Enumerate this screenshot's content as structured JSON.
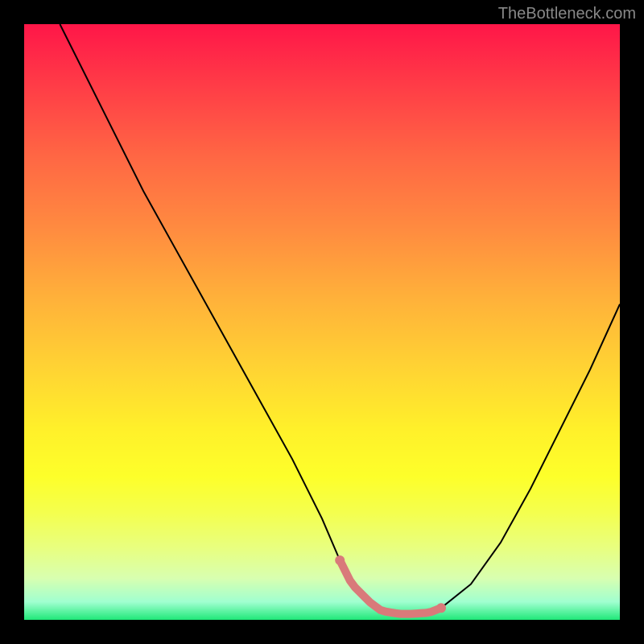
{
  "watermark": "TheBottleneck.com",
  "chart_data": {
    "type": "line",
    "title": "",
    "xlabel": "",
    "ylabel": "",
    "xlim": [
      0,
      100
    ],
    "ylim": [
      0,
      100
    ],
    "series": [
      {
        "name": "curve",
        "x": [
          6,
          10,
          15,
          20,
          25,
          30,
          35,
          40,
          45,
          50,
          53,
          55,
          58,
          60,
          63,
          65,
          68,
          70,
          75,
          80,
          85,
          90,
          95,
          100
        ],
        "values": [
          100,
          92,
          82,
          72,
          63,
          54,
          45,
          36,
          27,
          17,
          10,
          6,
          3,
          1.5,
          1,
          1,
          1.2,
          2,
          6,
          13,
          22,
          32,
          42,
          53
        ]
      }
    ],
    "highlight_range": {
      "x_start": 53,
      "x_end": 70,
      "color": "#d97a7a"
    },
    "gradient_stops": [
      {
        "pos": 0,
        "color": "#ff1648"
      },
      {
        "pos": 50,
        "color": "#ffd433"
      },
      {
        "pos": 80,
        "color": "#fdff2a"
      },
      {
        "pos": 100,
        "color": "#20e878"
      }
    ]
  }
}
